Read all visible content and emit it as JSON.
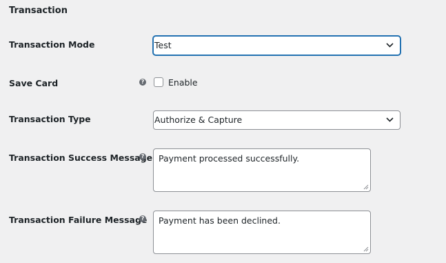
{
  "section": {
    "title": "Transaction"
  },
  "fields": {
    "mode": {
      "label": "Transaction Mode",
      "value": "Test"
    },
    "save_card": {
      "label": "Save Card",
      "checkbox_label": "Enable",
      "checked": false,
      "help_icon": "question-circle-icon"
    },
    "type": {
      "label": "Transaction Type",
      "value": "Authorize & Capture"
    },
    "success_message": {
      "label": "Transaction Success Message",
      "value": "Payment processed successfully.",
      "help_icon": "question-circle-icon"
    },
    "failure_message": {
      "label": "Transaction Failure Message",
      "value": "Payment has been declined.",
      "help_icon": "question-circle-icon"
    }
  },
  "colors": {
    "background": "#f0f0f1",
    "focus": "#2271b1",
    "border": "#8c8f94",
    "text": "#1d2327"
  }
}
